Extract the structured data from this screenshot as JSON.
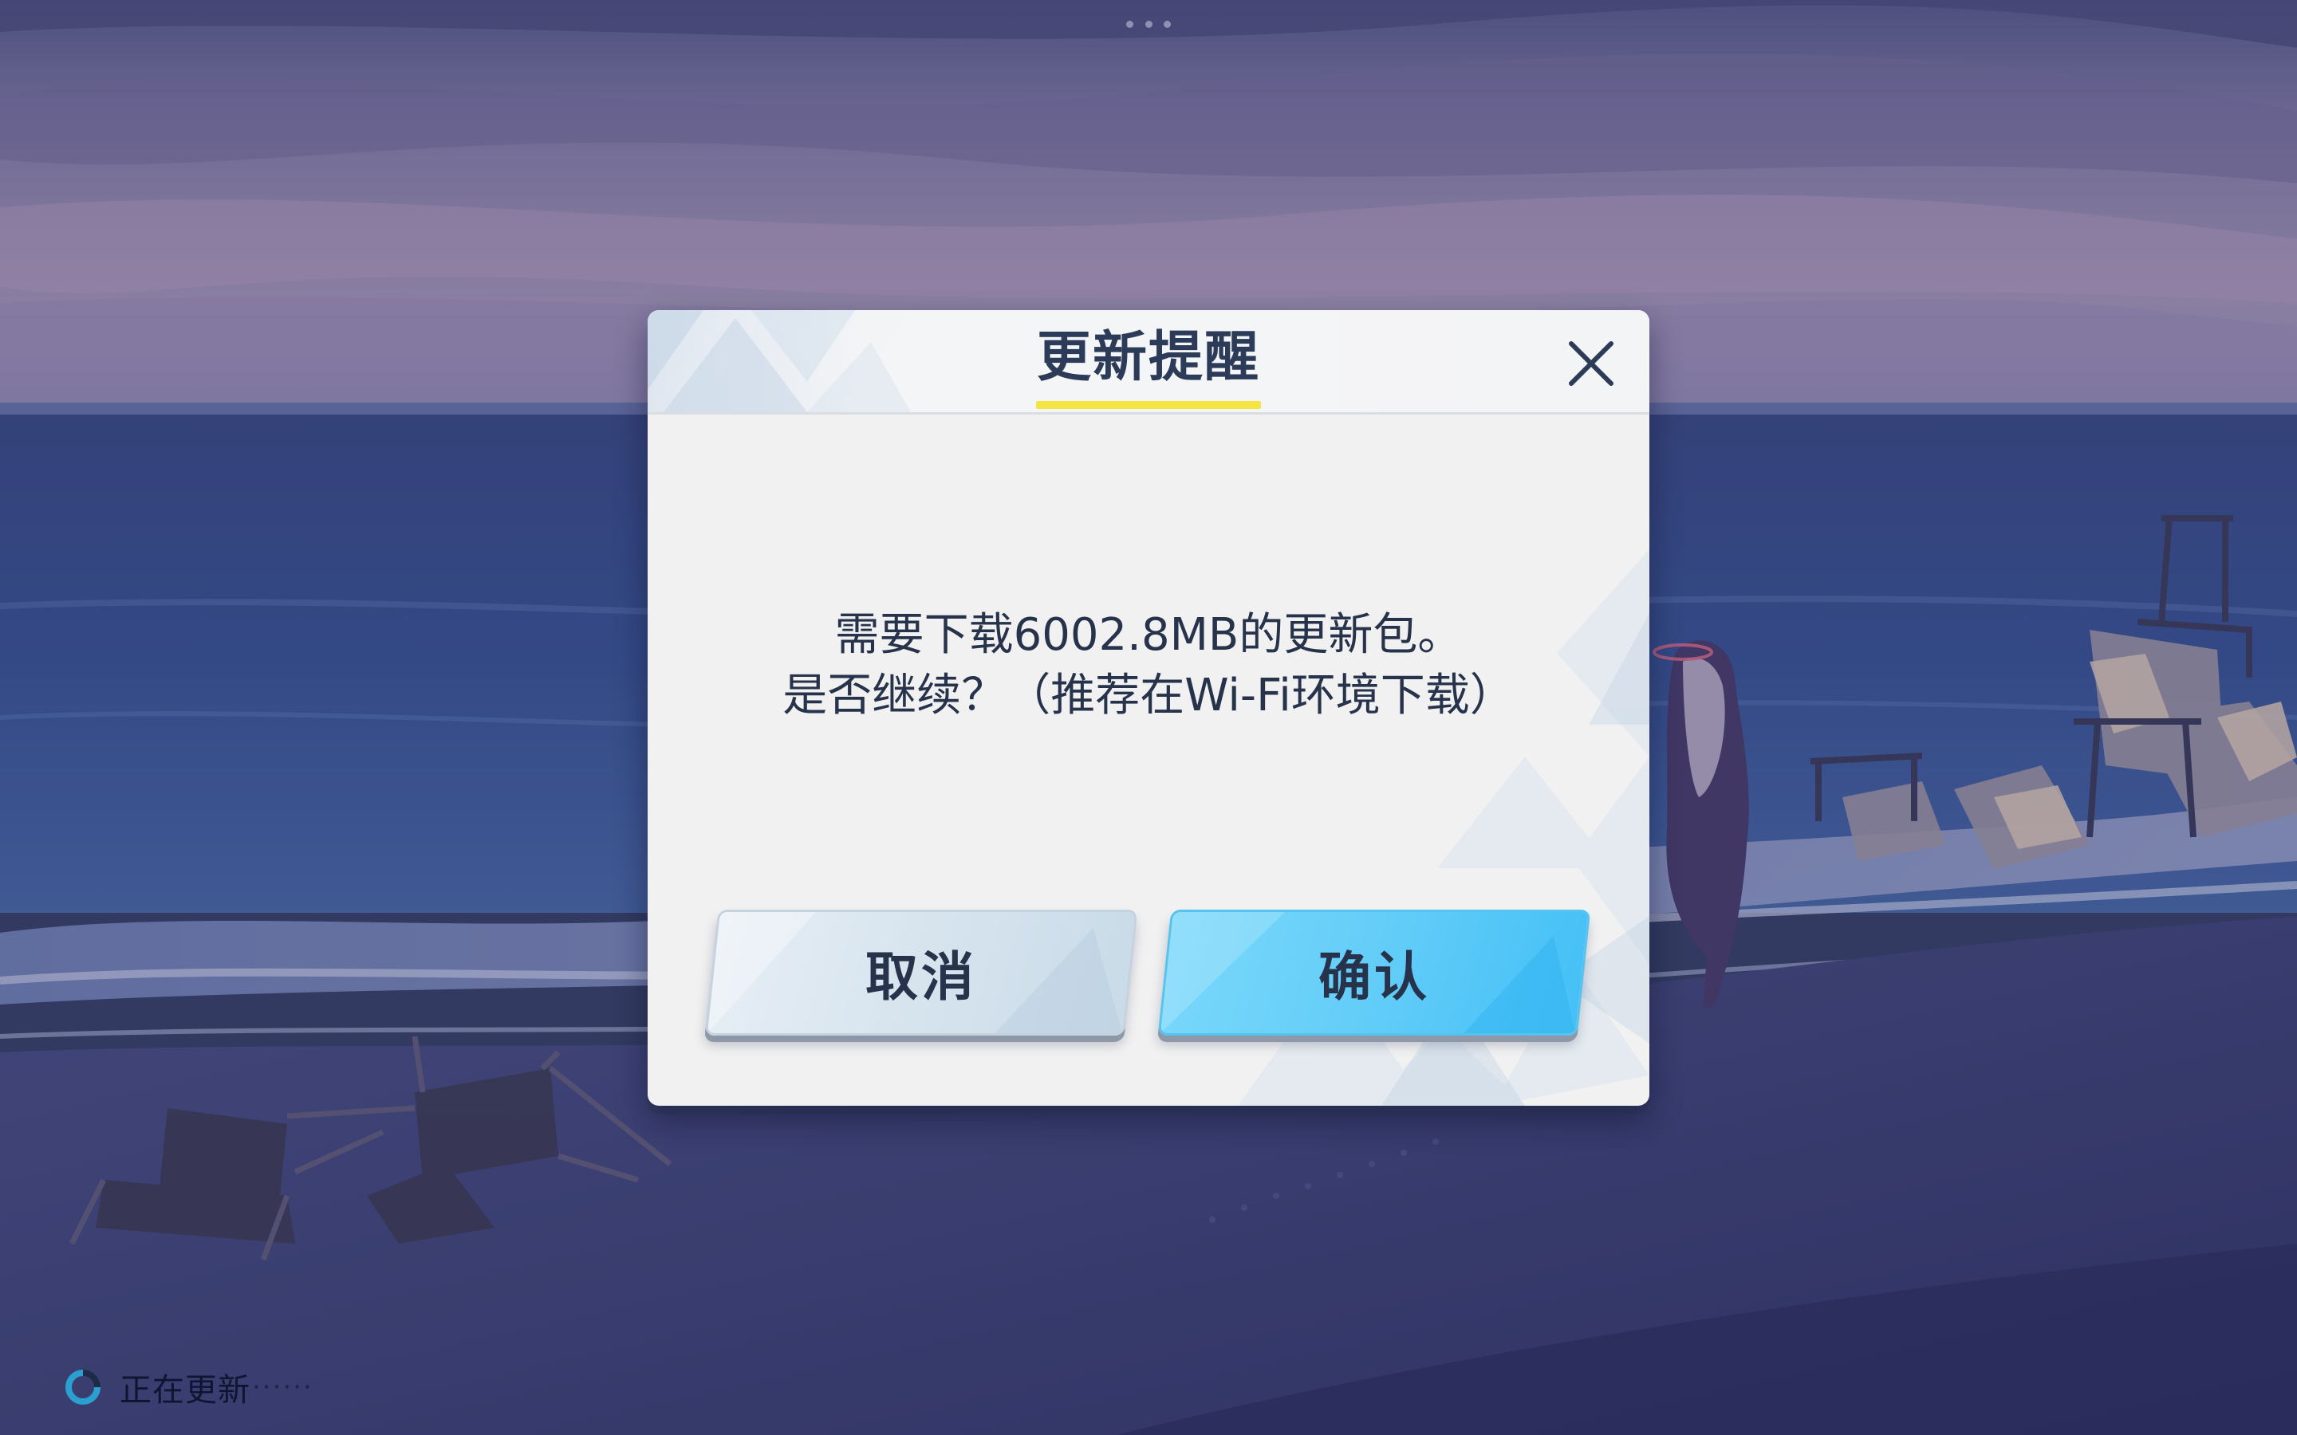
{
  "dialog": {
    "title": "更新提醒",
    "message_line1": "需要下载6002.8MB的更新包。",
    "message_line2": "是否继续？（推荐在Wi-Fi环境下载）",
    "cancel_label": "取消",
    "confirm_label": "确认"
  },
  "status": {
    "text": "正在更新",
    "dots": "······"
  },
  "icons": {
    "close": "close-icon",
    "loading": "loading-spinner-icon"
  },
  "colors": {
    "title_text": "#2c3b57",
    "title_underline": "#f4e542",
    "confirm_button": "#63cdf8",
    "cancel_button": "#d8e5ef",
    "dialog_background": "#f1f1f2"
  }
}
